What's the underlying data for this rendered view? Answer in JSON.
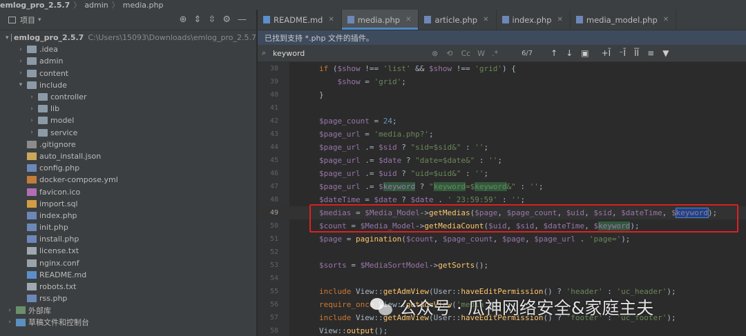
{
  "breadcrumb": {
    "project": "emlog_pro_2.5.7",
    "folder": "admin",
    "file": "media.php"
  },
  "project_panel": {
    "title": "项目",
    "root": {
      "name": "emlog_pro_2.5.7",
      "path": "C:\\Users\\15093\\Downloads\\emlog_pro_2.5.7"
    },
    "items": [
      {
        "label": ".idea",
        "icon": "folder-icon"
      },
      {
        "label": "admin",
        "icon": "folder-icon"
      },
      {
        "label": "content",
        "icon": "folder-icon"
      },
      {
        "label": "include",
        "icon": "folder-icon"
      },
      {
        "label": "controller",
        "icon": "folder-icon"
      },
      {
        "label": "lib",
        "icon": "folder-icon"
      },
      {
        "label": "model",
        "icon": "folder-icon"
      },
      {
        "label": "service",
        "icon": "folder-icon"
      },
      {
        "label": ".gitignore",
        "icon": "gitignore-file-icon"
      },
      {
        "label": "auto_install.json",
        "icon": "json-file-icon"
      },
      {
        "label": "config.php",
        "icon": "php-file-icon"
      },
      {
        "label": "docker-compose.yml",
        "icon": "yml-file-icon"
      },
      {
        "label": "favicon.ico",
        "icon": "ico-file-icon"
      },
      {
        "label": "import.sql",
        "icon": "sql-file-icon"
      },
      {
        "label": "index.php",
        "icon": "php-file-icon"
      },
      {
        "label": "init.php",
        "icon": "php-file-icon"
      },
      {
        "label": "install.php",
        "icon": "php-file-icon"
      },
      {
        "label": "license.txt",
        "icon": "txt-file-icon"
      },
      {
        "label": "nginx.conf",
        "icon": "conf-file-icon"
      },
      {
        "label": "README.md",
        "icon": "md-file-icon"
      },
      {
        "label": "robots.txt",
        "icon": "txt-file-icon"
      },
      {
        "label": "rss.php",
        "icon": "php-file-icon"
      },
      {
        "label": "外部库",
        "icon": "external-libraries-icon"
      },
      {
        "label": "草稿文件和控制台",
        "icon": "scratches-icon"
      }
    ]
  },
  "tabs": [
    {
      "label": "README.md",
      "icon": "md-file-icon",
      "active": false
    },
    {
      "label": "media.php",
      "icon": "php-file-icon",
      "active": true
    },
    {
      "label": "article.php",
      "icon": "php-file-icon",
      "active": false
    },
    {
      "label": "index.php",
      "icon": "php-file-icon",
      "active": false
    },
    {
      "label": "media_model.php",
      "icon": "php-file-icon",
      "active": false
    }
  ],
  "notice": "已找到支持 *.php 文件的插件。",
  "search": {
    "value": "keyword",
    "options": [
      "Cc",
      "W",
      ".*"
    ],
    "match_count": "6/7"
  },
  "code_lines": [
    {
      "num": "38",
      "text": "if ($show !== 'list' && $show !== 'grid') {"
    },
    {
      "num": "39",
      "text": "    $show = 'grid';"
    },
    {
      "num": "40",
      "text": "}"
    },
    {
      "num": "41",
      "text": ""
    },
    {
      "num": "42",
      "text": "$page_count = 24;"
    },
    {
      "num": "43",
      "text": "$page_url = 'media.php?';"
    },
    {
      "num": "44",
      "text": "$page_url .= $sid ? \"sid=$sid&\" : '';"
    },
    {
      "num": "45",
      "text": "$page_url .= $date ? \"date=$date&\" : '';"
    },
    {
      "num": "46",
      "text": "$page_url .= $uid ? \"uid=$uid&\" : '';"
    },
    {
      "num": "47",
      "text": "$page_url .= $keyword ? \"keyword=$keyword&\" : '';"
    },
    {
      "num": "48",
      "text": "$dateTime = $date ? $date . ' 23:59:59' : '';"
    },
    {
      "num": "49",
      "text": "$medias = $Media_Model->getMedias($page, $page_count, $uid, $sid, $dateTime, $keyword);"
    },
    {
      "num": "50",
      "text": "$count = $Media_Model->getMediaCount($uid, $sid, $dateTime, $keyword);"
    },
    {
      "num": "51",
      "text": "$page = pagination($count, $page_count, $page, $page_url . 'page=');"
    },
    {
      "num": "52",
      "text": ""
    },
    {
      "num": "53",
      "text": "$sorts = $MediaSortModel->getSorts();"
    },
    {
      "num": "54",
      "text": ""
    },
    {
      "num": "55",
      "text": "include View::getAdmView(User::haveEditPermission() ? 'header' : 'uc_header');"
    },
    {
      "num": "56",
      "text": "require_once View::getAdmView('media');"
    },
    {
      "num": "57",
      "text": "include View::getAdmView(User::haveEditPermission() ? 'footer' : 'uc_footer');"
    },
    {
      "num": "58",
      "text": "View::output();"
    }
  ],
  "watermark": "公众号 · 瓜神网络安全&家庭主夫"
}
